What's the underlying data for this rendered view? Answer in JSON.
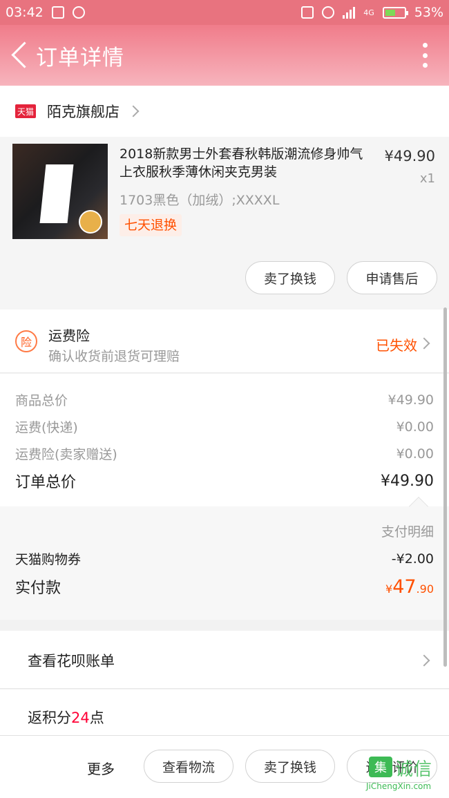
{
  "status_bar": {
    "time": "03:42",
    "battery": "53%",
    "battery_level": 0.53,
    "network": "4G"
  },
  "header": {
    "title": "订单详情"
  },
  "shop": {
    "badge": "天猫",
    "name": "陌克旗舰店"
  },
  "item": {
    "name": "2018新款男士外套春秋韩版潮流修身帅气上衣服秋季薄休闲夹克男装",
    "price": "¥49.90",
    "quantity": "x1",
    "sku": "1703黑色（加绒）;XXXXL",
    "tag": "七天退换",
    "buttons": [
      "卖了换钱",
      "申请售后"
    ]
  },
  "insurance": {
    "icon_text": "险",
    "title": "运费险",
    "subtitle": "确认收货前退货可理赔",
    "status": "已失效"
  },
  "costs": [
    {
      "label": "商品总价",
      "value": "¥49.90"
    },
    {
      "label": "运费(快递)",
      "value": "¥0.00"
    },
    {
      "label": "运费险(卖家赠送)",
      "value": "¥0.00"
    }
  ],
  "order_total": {
    "label": "订单总价",
    "value": "¥49.90"
  },
  "payment": {
    "detail_label": "支付明细",
    "coupon_label": "天猫购物券",
    "coupon_value": "-¥2.00",
    "actual_label": "实付款",
    "actual_currency": "¥",
    "actual_int": "47",
    "actual_dec": ".90"
  },
  "huabei": {
    "label": "查看花呗账单"
  },
  "points": {
    "prefix": "返积分",
    "number": "24",
    "suffix": "点"
  },
  "bottom_bar": {
    "more": "更多",
    "buttons": [
      "查看物流",
      "卖了换钱",
      "追加评价"
    ]
  },
  "watermark": {
    "icon": "集",
    "cn": "诚信",
    "en": "JiChengXin.com"
  },
  "colors": {
    "accent": "#ff5000",
    "header": "#f07c8a",
    "tmall": "#e4233b",
    "points": "#ff0036"
  }
}
